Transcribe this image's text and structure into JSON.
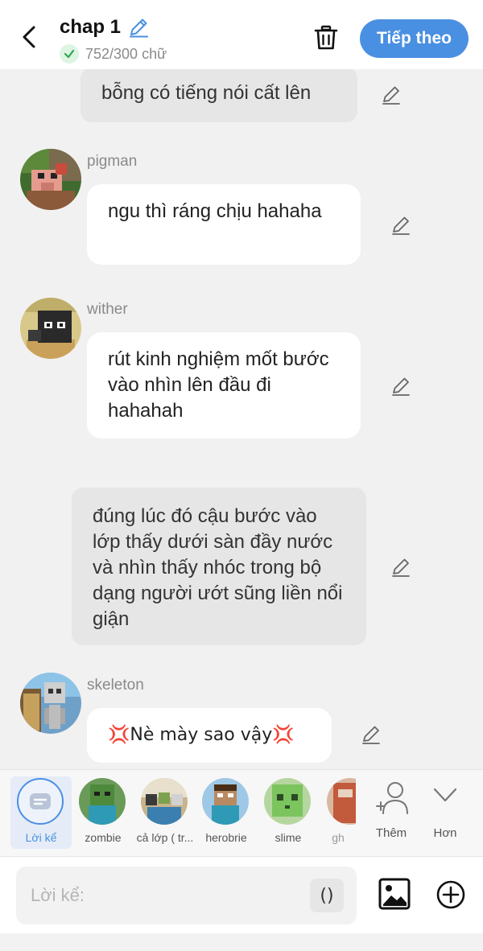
{
  "header": {
    "title": "chap 1",
    "word_count": "752/300 chữ",
    "next_label": "Tiếp theo",
    "accent_color": "#4a90e2"
  },
  "messages": [
    {
      "type": "narration",
      "text": "bỗng có tiếng nói cất lên"
    },
    {
      "type": "speech",
      "character": "pigman",
      "text": "ngu thì ráng chịu hahaha"
    },
    {
      "type": "speech",
      "character": "wither",
      "text": "rút kinh nghiệm mốt bước vào nhìn lên đầu đi hahahah"
    },
    {
      "type": "narration",
      "text": "đúng lúc đó cậu bước vào lớp thấy dưới sàn đầy nước và nhìn thấy nhóc trong bộ dạng người ướt sũng liền nổi giận"
    },
    {
      "type": "speech",
      "character": "skeleton",
      "text": "💢Nè mày sao vậy💢"
    }
  ],
  "character_bar": {
    "items": [
      {
        "label": "Lời kể",
        "selected": true
      },
      {
        "label": "zombie"
      },
      {
        "label": "cả lớp ( tr..."
      },
      {
        "label": "herobrie"
      },
      {
        "label": "slime"
      },
      {
        "label": "gh"
      }
    ],
    "add_label": "Thêm",
    "more_label": "Hơn"
  },
  "input": {
    "placeholder": "Lời kể:",
    "paren_label": "()"
  }
}
